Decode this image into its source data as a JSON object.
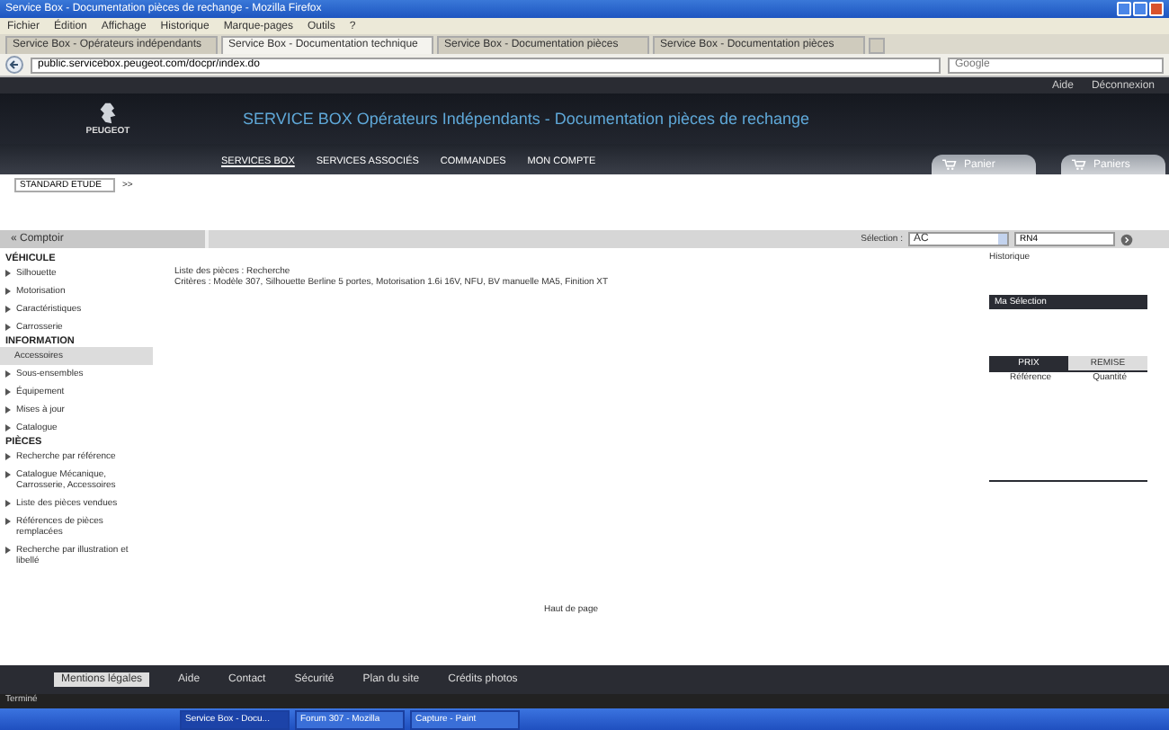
{
  "window": {
    "title": "Service Box - Documentation pièces de rechange - Mozilla Firefox"
  },
  "menu_bar": [
    "Fichier",
    "Édition",
    "Affichage",
    "Historique",
    "Marque-pages",
    "Outils",
    "?"
  ],
  "browser_tabs": [
    {
      "label": "Service Box - Opérateurs indépendants",
      "selected": false
    },
    {
      "label": "Service Box - Documentation technique",
      "selected": true
    },
    {
      "label": "Service Box - Documentation pièces",
      "selected": false
    },
    {
      "label": "Service Box - Documentation pièces",
      "selected": false
    }
  ],
  "address_bar": {
    "value": "public.servicebox.peugeot.com/docpr/index.do",
    "search_placeholder": "Google"
  },
  "top_links": [
    "Aide",
    "Déconnexion"
  ],
  "header": {
    "title": "SERVICE BOX Opérateurs Indépendants - Documentation pièces de rechange",
    "logo_text": "PEUGEOT",
    "nav": [
      {
        "label": "SERVICES BOX",
        "selected": true
      },
      {
        "label": "SERVICES ASSOCIÉS",
        "selected": false
      },
      {
        "label": "COMMANDES",
        "selected": false
      },
      {
        "label": "MON COMPTE",
        "selected": false
      }
    ],
    "cart_tabs": [
      "Panier",
      "Paniers"
    ]
  },
  "breadcrumb": {
    "value": "STANDARD ETUDE",
    "more": ">>"
  },
  "toolbar": {
    "left": "« Comptoir",
    "selection_label": "Sélection :",
    "select_value": "AC",
    "input_value": "RN4"
  },
  "sidebar": [
    {
      "heading": "VÉHICULE",
      "items": [
        {
          "label": "Silhouette",
          "selected": false
        },
        {
          "label": "Motorisation",
          "selected": false
        },
        {
          "label": "Caractéristiques",
          "selected": false
        },
        {
          "label": "Carrosserie",
          "selected": false
        }
      ]
    },
    {
      "heading": "INFORMATION",
      "items": [
        {
          "label": "Accessoires",
          "selected": true
        },
        {
          "label": "Sous-ensembles",
          "selected": false
        },
        {
          "label": "Équipement",
          "selected": false
        },
        {
          "label": "Mises à jour",
          "selected": false
        },
        {
          "label": "Catalogue",
          "selected": false
        }
      ]
    },
    {
      "heading": "PIÈCES",
      "items": [
        {
          "label": "Recherche par référence",
          "selected": false
        },
        {
          "label": "Catalogue Mécanique, Carrosserie, Accessoires",
          "selected": false
        },
        {
          "label": "Liste des pièces vendues",
          "selected": false
        },
        {
          "label": "Références de pièces remplacées",
          "selected": false
        },
        {
          "label": "Recherche par illustration et libellé",
          "selected": false
        }
      ]
    }
  ],
  "content": {
    "lines": [
      "Liste des pièces : Recherche",
      "Critères : Modèle 307, Silhouette Berline 5 portes, Motorisation 1.6i 16V, NFU, BV manuelle MA5, Finition XT"
    ]
  },
  "right_panel": {
    "history_link": "Historique",
    "selection_title": "Ma Sélection",
    "tabs": [
      {
        "label": "PRIX",
        "selected": true
      },
      {
        "label": "REMISE",
        "selected": false
      }
    ],
    "columns": [
      "Référence",
      "Quantité"
    ]
  },
  "back_to_top": "Haut de page",
  "footer": {
    "button": "Mentions légales",
    "links": [
      "Aide",
      "Contact",
      "Sécurité",
      "Plan du site",
      "Crédits photos"
    ],
    "status": "Terminé"
  },
  "taskbar": [
    {
      "label": "Service Box - Docu...",
      "selected": true
    },
    {
      "label": "Forum 307 - Mozilla",
      "selected": false
    },
    {
      "label": "Capture - Paint",
      "selected": false
    }
  ]
}
